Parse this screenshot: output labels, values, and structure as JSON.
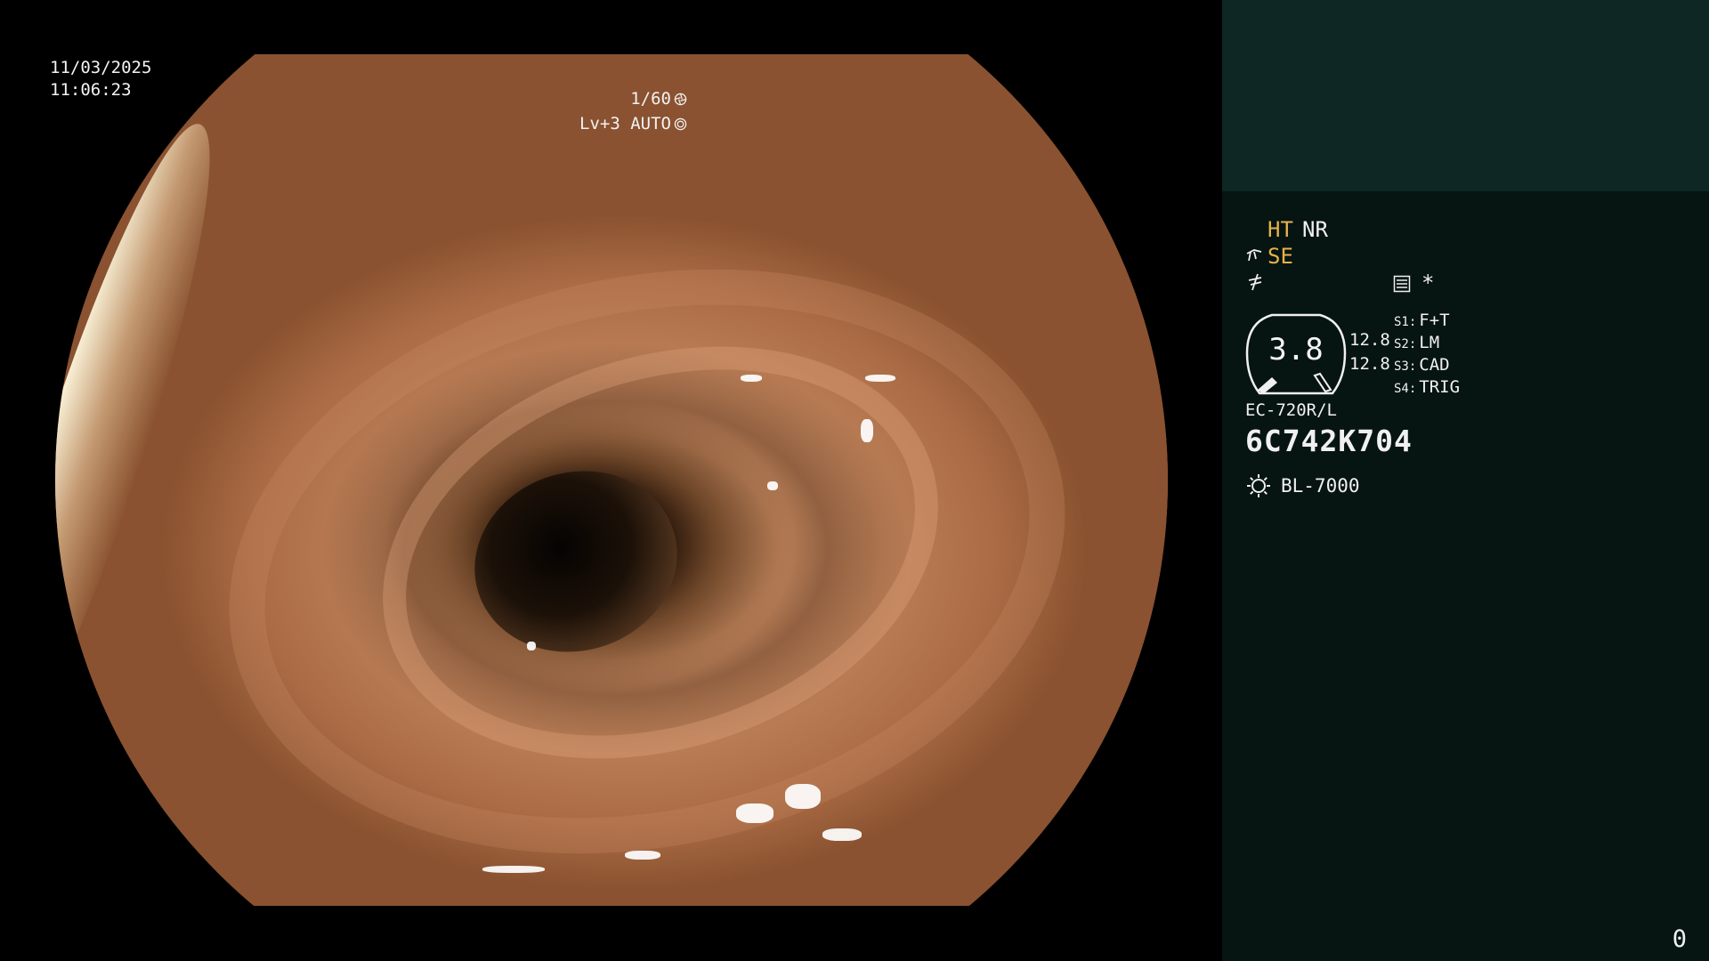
{
  "overlay": {
    "date": "11/03/2025",
    "time": "11:06:23",
    "shutter": "1/60",
    "shutter_icon": "shutter-speed-icon",
    "level": "Lv+3",
    "iris_mode": "AUTO",
    "iris_icon": "iris-icon"
  },
  "panel": {
    "ht": "HT",
    "nr": "NR",
    "se": "SE",
    "se_icon": "structure-enhancement-icon",
    "freeze_icon": "freeze-icon",
    "memo_icon": "memo-icon",
    "asterisk": "*",
    "zoom": "3.8",
    "angle_top": "12.8",
    "angle_bottom": "12.8",
    "switches": [
      {
        "key": "S1:",
        "label": "F+T"
      },
      {
        "key": "S2:",
        "label": "LM"
      },
      {
        "key": "S3:",
        "label": "CAD"
      },
      {
        "key": "S4:",
        "label": "TRIG"
      }
    ],
    "scope_model": "EC-720R/L",
    "scope_serial": "6C742K704",
    "light_icon": "light-source-icon",
    "light_source": "BL-7000",
    "counter": "0"
  },
  "colors": {
    "panel_background": "#061412",
    "panel_header": "#0f2724",
    "highlight": "#e8b24a",
    "text": "#f0f0f0"
  }
}
